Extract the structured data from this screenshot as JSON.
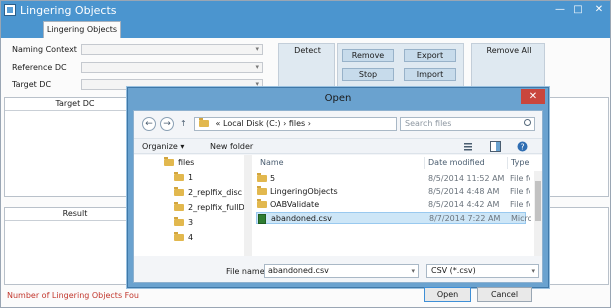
{
  "window": {
    "title": "Lingering Objects",
    "controls": {
      "minimize": "—",
      "maximize": "□",
      "close": "✕"
    }
  },
  "tabs": [
    {
      "label": "Lingering Objects",
      "active": true
    }
  ],
  "form": {
    "naming_context_label": "Naming Context",
    "reference_dc_label": "Reference DC",
    "target_dc_label": "Target DC"
  },
  "actions": {
    "detect": "Detect",
    "remove": "Remove",
    "stop": "Stop",
    "export": "Export",
    "import": "Import",
    "remove_all": "Remove All"
  },
  "grids": {
    "top_header": "Target DC",
    "bottom_header": "Result"
  },
  "status": {
    "text": "Number of Lingering Objects Fou",
    "color": "#c2362c"
  },
  "dialog": {
    "title": "Open",
    "close": "✕",
    "nav": {
      "back": "←",
      "forward": "→",
      "up": "↑"
    },
    "address": {
      "prefix": "«",
      "segments": [
        "Local Disk (C:)",
        "files"
      ],
      "separator": "›"
    },
    "search_placeholder": "Search files",
    "toolbar": {
      "organize": "Organize ▾",
      "new_folder": "New folder"
    },
    "tree": [
      {
        "label": "files",
        "level": 0
      },
      {
        "label": "1",
        "level": 1
      },
      {
        "label": "2_replfix_disc",
        "level": 1
      },
      {
        "label": "2_replfix_fullD",
        "level": 1
      },
      {
        "label": "3",
        "level": 1
      },
      {
        "label": "4",
        "level": 1
      }
    ],
    "columns": {
      "name": "Name",
      "date": "Date modified",
      "type": "Type"
    },
    "files": [
      {
        "name": "5",
        "date": "8/5/2014 11:52 AM",
        "type": "File fol",
        "kind": "folder",
        "selected": false
      },
      {
        "name": "LingeringObjects",
        "date": "8/5/2014 4:48 AM",
        "type": "File fol",
        "kind": "folder",
        "selected": false
      },
      {
        "name": "OABValidate",
        "date": "8/5/2014 4:42 AM",
        "type": "File fol",
        "kind": "folder",
        "selected": false
      },
      {
        "name": "abandoned.csv",
        "date": "8/7/2014 7:22 AM",
        "type": "Micros",
        "kind": "csv",
        "selected": true
      }
    ],
    "file_name_label": "File name:",
    "file_name_value": "abandoned.csv",
    "file_type": "CSV (*.csv)",
    "open_button": "Open",
    "cancel_button": "Cancel"
  }
}
